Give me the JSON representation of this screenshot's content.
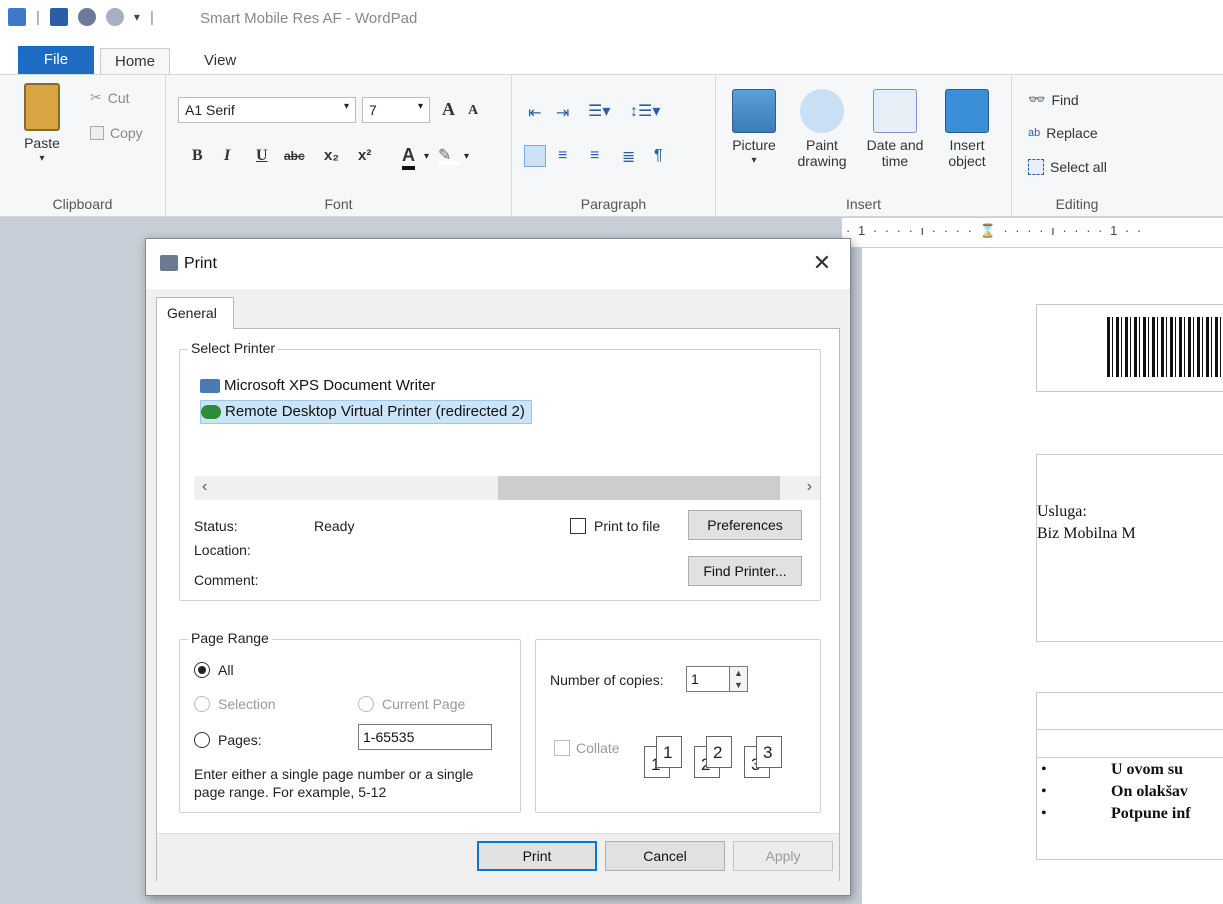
{
  "window": {
    "title": "Smart Mobile Res AF - WordPad"
  },
  "tabs": [
    {
      "label": "File"
    },
    {
      "label": "Home"
    },
    {
      "label": "View"
    }
  ],
  "ribbon": {
    "clipboard": {
      "paste": "Paste",
      "cut": "Cut",
      "copy": "Copy",
      "label": "Clipboard"
    },
    "font": {
      "family": "A1 Serif",
      "size": "7",
      "bold": "B",
      "italic": "I",
      "underline": "U",
      "strike": "abc",
      "subscript": "x₂",
      "superscript": "x²",
      "color": "A",
      "grow": "A",
      "shrink": "A",
      "label": "Font"
    },
    "paragraph": {
      "label": "Paragraph"
    },
    "insert": {
      "picture": "Picture",
      "paint_1": "Paint",
      "paint_2": "drawing",
      "datetime_1": "Date and",
      "datetime_2": "time",
      "object_1": "Insert",
      "object_2": "object",
      "label": "Insert"
    },
    "editing": {
      "find": "Find",
      "replace": "Replace",
      "select_all": "Select all",
      "label": "Editing"
    }
  },
  "ruler": {
    "text": "· 1 · · · · ı · · · · ⌛ · · · · ı · · · · 1 · ·"
  },
  "document": {
    "usluga": "Usluga:",
    "biz": "Biz Mobilna M",
    "bullets": [
      "U ovom su",
      "On olakšav",
      "Potpune inf"
    ],
    "bullet_char": "•"
  },
  "dialog": {
    "title": "Print",
    "close": "✕",
    "tab": "General",
    "select_printer": {
      "label": "Select Printer",
      "printers": [
        {
          "name": "Microsoft XPS Document Writer"
        },
        {
          "name": "Remote Desktop Virtual Printer (redirected 2)"
        }
      ],
      "scroll_left": "‹",
      "scroll_right": "›",
      "status_label": "Status:",
      "status_value": "Ready",
      "location_label": "Location:",
      "comment_label": "Comment:",
      "print_to_file": "Print to file",
      "preferences": "Preferences",
      "find_printer": "Find Printer..."
    },
    "page_range": {
      "label": "Page Range",
      "all": "All",
      "selection": "Selection",
      "current_page": "Current Page",
      "pages": "Pages:",
      "pages_value": "1-65535",
      "help_1": "Enter either a single page number or a single",
      "help_2": "page range.  For example, 5-12"
    },
    "copies": {
      "label": "Number of copies:",
      "value": "1",
      "up": "▲",
      "down": "▼",
      "collate": "Collate",
      "collate_pages": [
        "1",
        "1",
        "2",
        "2",
        "3",
        "3"
      ]
    },
    "buttons": {
      "print": "Print",
      "cancel": "Cancel",
      "apply": "Apply"
    }
  }
}
